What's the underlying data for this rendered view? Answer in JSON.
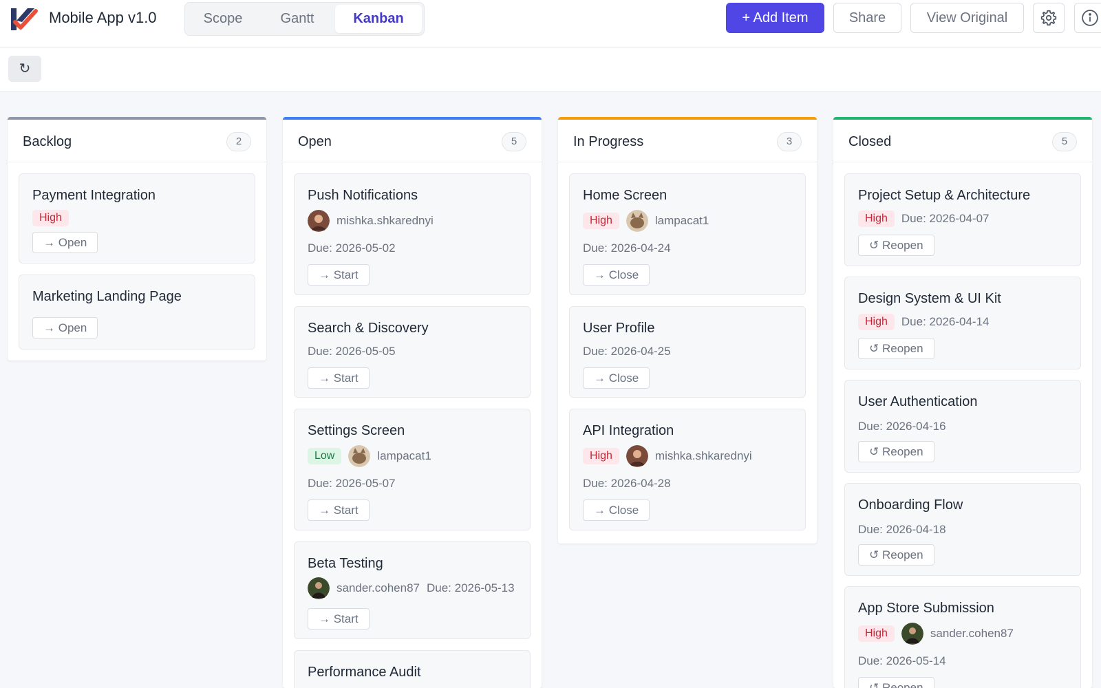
{
  "app": {
    "title": "Mobile App v1.0",
    "logo_icon": "app-logo-check-icon",
    "colors": {
      "brand_navy": "#2d3a66",
      "brand_red": "#e8503a"
    }
  },
  "tabs": [
    {
      "label": "Scope",
      "active": false
    },
    {
      "label": "Gantt",
      "active": false
    },
    {
      "label": "Kanban",
      "active": true
    }
  ],
  "actions": {
    "add_item": "+ Add Item",
    "share": "Share",
    "view_original": "View Original",
    "settings_icon": "gear-icon",
    "info_icon": "info-icon"
  },
  "toolbar": {
    "refresh": "↻"
  },
  "colors": {
    "primary": "#4f46e5",
    "backlog": "#8e98a8",
    "open": "#3b82f6",
    "in_progress": "#f59e0b",
    "closed": "#22b573",
    "priority_high": "#c62839",
    "priority_low": "#1b7b43"
  },
  "columns": [
    {
      "title": "Backlog",
      "count": "2",
      "cards": [
        {
          "title": "Payment Integration",
          "priority": "High",
          "button": "→ Open"
        },
        {
          "title": "Marketing Landing Page",
          "button": "→ Open"
        }
      ]
    },
    {
      "title": "Open",
      "count": "5",
      "cards": [
        {
          "title": "Push Notifications",
          "assignee": "mishka.shkarednyi",
          "due": "Due: 2026-05-02",
          "button": "→ Start"
        },
        {
          "title": "Search & Discovery",
          "due": "Due: 2026-05-05",
          "button": "→ Start"
        },
        {
          "title": "Settings Screen",
          "priority": "Low",
          "assignee": "lampacat1",
          "due": "Due: 2026-05-07",
          "button": "→ Start"
        },
        {
          "title": "Beta Testing",
          "assignee": "sander.cohen87",
          "due": "Due: 2026-05-13",
          "button": "→ Start"
        },
        {
          "title": "Performance Audit"
        }
      ]
    },
    {
      "title": "In Progress",
      "count": "3",
      "cards": [
        {
          "title": "Home Screen",
          "priority": "High",
          "assignee": "lampacat1",
          "due": "Due: 2026-04-24",
          "button": "→ Close"
        },
        {
          "title": "User Profile",
          "due": "Due: 2026-04-25",
          "button": "→ Close"
        },
        {
          "title": "API Integration",
          "priority": "High",
          "assignee": "mishka.shkarednyi",
          "due": "Due: 2026-04-28",
          "button": "→ Close"
        }
      ]
    },
    {
      "title": "Closed",
      "count": "5",
      "cards": [
        {
          "title": "Project Setup & Architecture",
          "priority": "High",
          "due": "Due: 2026-04-07",
          "button": "↺ Reopen"
        },
        {
          "title": "Design System & UI Kit",
          "priority": "High",
          "due": "Due: 2026-04-14",
          "button": "↺ Reopen"
        },
        {
          "title": "User Authentication",
          "due": "Due: 2026-04-16",
          "button": "↺ Reopen"
        },
        {
          "title": "Onboarding Flow",
          "due": "Due: 2026-04-18",
          "button": "↺ Reopen"
        },
        {
          "title": "App Store Submission",
          "priority": "High",
          "assignee": "sander.cohen87",
          "due": "Due: 2026-05-14",
          "button": "↺ Reopen"
        }
      ]
    }
  ]
}
